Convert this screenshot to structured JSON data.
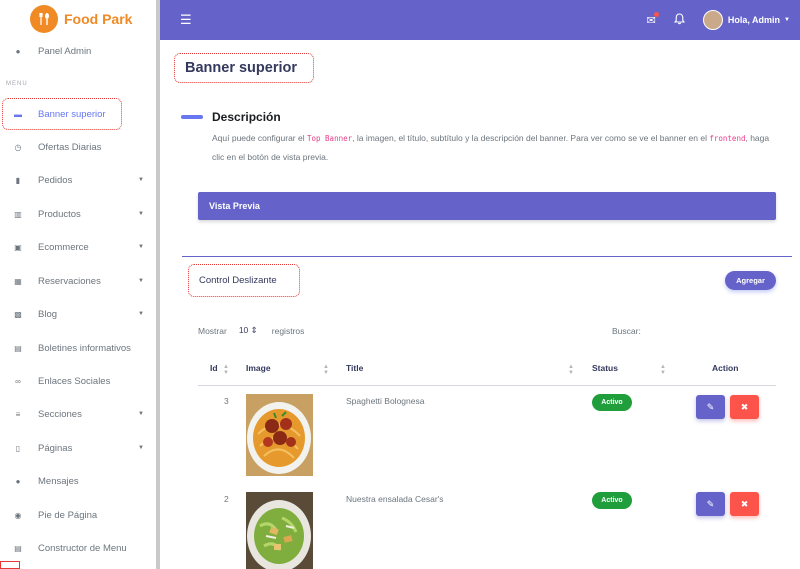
{
  "brand": {
    "name": "Food Park",
    "logo_icon": "fork-spoon-icon",
    "accent": "#f08a24"
  },
  "sidebar": {
    "admin_label": "Panel Admin",
    "menu_header": "MENU",
    "items": [
      {
        "label": "Banner superior",
        "icon": "banner-icon",
        "active": true,
        "caret": false
      },
      {
        "label": "Ofertas Diarias",
        "icon": "clock-icon",
        "caret": false
      },
      {
        "label": "Pedidos",
        "icon": "truck-icon",
        "caret": true
      },
      {
        "label": "Productos",
        "icon": "cart-icon",
        "caret": true
      },
      {
        "label": "Ecommerce",
        "icon": "store-icon",
        "caret": true
      },
      {
        "label": "Reservaciones",
        "icon": "chair-icon",
        "caret": true
      },
      {
        "label": "Blog",
        "icon": "blog-icon",
        "caret": true
      },
      {
        "label": "Boletines informativos",
        "icon": "newsletter-icon",
        "caret": false
      },
      {
        "label": "Enlaces Sociales",
        "icon": "link-icon",
        "caret": false
      },
      {
        "label": "Secciones",
        "icon": "list-icon",
        "caret": true
      },
      {
        "label": "Páginas",
        "icon": "page-icon",
        "caret": true
      },
      {
        "label": "Mensajes",
        "icon": "chat-icon",
        "caret": false
      },
      {
        "label": "Pie de Página",
        "icon": "info-icon",
        "caret": false
      },
      {
        "label": "Constructor de Menu",
        "icon": "menu-builder-icon",
        "caret": false
      }
    ]
  },
  "topbar": {
    "greeting": "Hola, Admin",
    "color": "#6563c9"
  },
  "page": {
    "title": "Banner superior",
    "description_title": "Descripción",
    "desc_part1": "Aquí puede configurar el ",
    "desc_code1": "Top Banner",
    "desc_part2": ", la imagen, el título, subtítulo y la descripción del banner. Para ver como se ve el banner en el ",
    "desc_code2": "frontend",
    "desc_part3": ", haga clic en el botón de vista previa.",
    "preview_label": "Vista Previa"
  },
  "table_section": {
    "title": "Control Deslizante",
    "add_label": "Agregar",
    "show_label": "Mostrar",
    "page_length": "10",
    "records_label": "registros",
    "search_label": "Buscar:",
    "columns": [
      "Id",
      "Image",
      "Title",
      "Status",
      "Action"
    ],
    "rows": [
      {
        "id": "3",
        "title": "Spaghetti Bolognesa",
        "status": "Activo"
      },
      {
        "id": "2",
        "title": "Nuestra ensalada Cesar's",
        "status": "Activo"
      }
    ]
  },
  "colors": {
    "primary": "#6563c9",
    "success": "#1f9e3b",
    "danger": "#fc544b"
  }
}
